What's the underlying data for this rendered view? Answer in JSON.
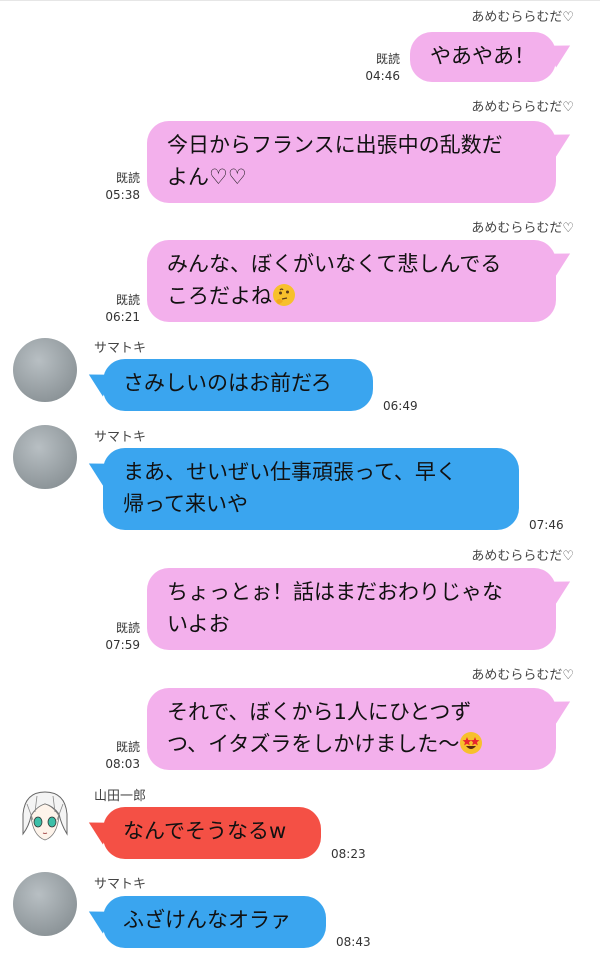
{
  "messages": [
    {
      "sender": "あめむららむだ♡",
      "text": "やあやあ！",
      "read": "既読",
      "time": "04:46"
    },
    {
      "sender": "あめむららむだ♡",
      "line1": "今日からフランスに出張中の乱数だ",
      "line2": "よん♡♡",
      "read": "既読",
      "time": "05:38"
    },
    {
      "sender": "あめむららむだ♡",
      "line1": "みんな、ぼくがいなくて悲しんでる",
      "line2": "ころだよね",
      "emoji": "thinking-face",
      "read": "既読",
      "time": "06:21"
    },
    {
      "sender": "サマトキ",
      "text": "さみしいのはお前だろ",
      "time": "06:49"
    },
    {
      "sender": "サマトキ",
      "line1": "まあ、せいぜい仕事頑張って、早く",
      "line2": "帰って来いや",
      "time": "07:46"
    },
    {
      "sender": "あめむららむだ♡",
      "line1": "ちょっとぉ！話はまだおわりじゃな",
      "line2": "いよお",
      "read": "既読",
      "time": "07:59"
    },
    {
      "sender": "あめむららむだ♡",
      "line1": "それで、ぼくから1人にひとつず",
      "line2": "つ、イタズラをしかけました〜",
      "emoji": "star-struck-face",
      "read": "既読",
      "time": "08:03"
    },
    {
      "sender": "山田一郎",
      "text": "なんでそうなるw",
      "time": "08:23"
    },
    {
      "sender": "サマトキ",
      "text": "ふざけんなオラァ",
      "time": "08:43"
    }
  ],
  "colors": {
    "self_bubble": "#f3b0ec",
    "samatoki_bubble": "#3aa5ef",
    "ichiro_bubble": "#f45045"
  }
}
